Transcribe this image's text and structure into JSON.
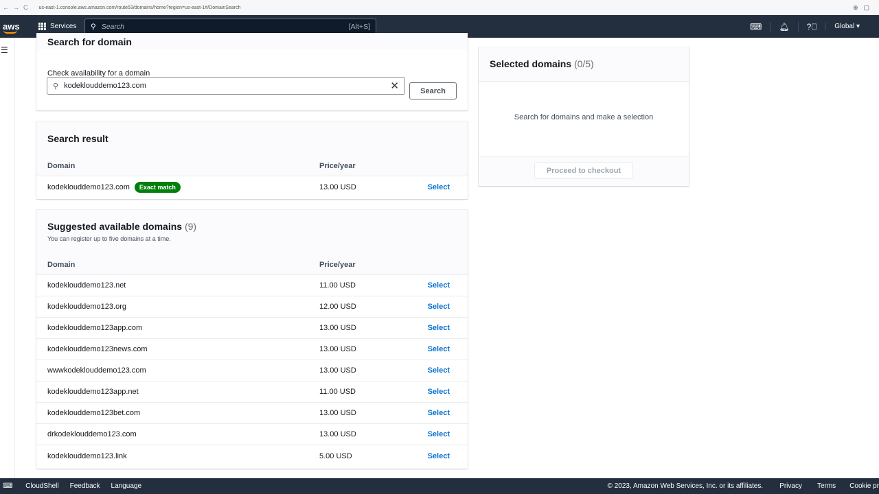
{
  "browser": {
    "url": "us-east-1.console.aws.amazon.com/route53/domains/home?region=us-east-1#/DomainSearch"
  },
  "nav": {
    "logo": "aws",
    "services": "Services",
    "search_placeholder": "Search",
    "search_shortcut": "[Alt+S]",
    "region": "Global ▾"
  },
  "search_panel": {
    "title": "Search for domain",
    "label": "Check availability for a domain",
    "value": "kodeklouddemo123.com",
    "button": "Search"
  },
  "result_panel": {
    "title": "Search result",
    "col_domain": "Domain",
    "col_price": "Price/year",
    "row": {
      "domain": "kodeklouddemo123.com",
      "badge": "Exact match",
      "price": "13.00 USD",
      "action": "Select"
    }
  },
  "suggested_panel": {
    "title": "Suggested available domains",
    "count": "(9)",
    "subtitle": "You can register up to five domains at a time.",
    "col_domain": "Domain",
    "col_price": "Price/year",
    "rows": [
      {
        "domain": "kodeklouddemo123.net",
        "price": "11.00 USD",
        "action": "Select"
      },
      {
        "domain": "kodeklouddemo123.org",
        "price": "12.00 USD",
        "action": "Select"
      },
      {
        "domain": "kodeklouddemo123app.com",
        "price": "13.00 USD",
        "action": "Select"
      },
      {
        "domain": "kodeklouddemo123news.com",
        "price": "13.00 USD",
        "action": "Select"
      },
      {
        "domain": "wwwkodeklouddemo123.com",
        "price": "13.00 USD",
        "action": "Select"
      },
      {
        "domain": "kodeklouddemo123app.net",
        "price": "11.00 USD",
        "action": "Select"
      },
      {
        "domain": "kodeklouddemo123bet.com",
        "price": "13.00 USD",
        "action": "Select"
      },
      {
        "domain": "drkodeklouddemo123.com",
        "price": "13.00 USD",
        "action": "Select"
      },
      {
        "domain": "kodeklouddemo123.link",
        "price": "5.00 USD",
        "action": "Select"
      }
    ]
  },
  "selected_panel": {
    "title": "Selected domains",
    "count": "(0/5)",
    "empty": "Search for domains and make a selection",
    "button": "Proceed to checkout"
  },
  "footer": {
    "cloudshell": "CloudShell",
    "feedback": "Feedback",
    "language": "Language",
    "copyright": "© 2023, Amazon Web Services, Inc. or its affiliates.",
    "privacy": "Privacy",
    "terms": "Terms",
    "cookie": "Cookie pr"
  }
}
